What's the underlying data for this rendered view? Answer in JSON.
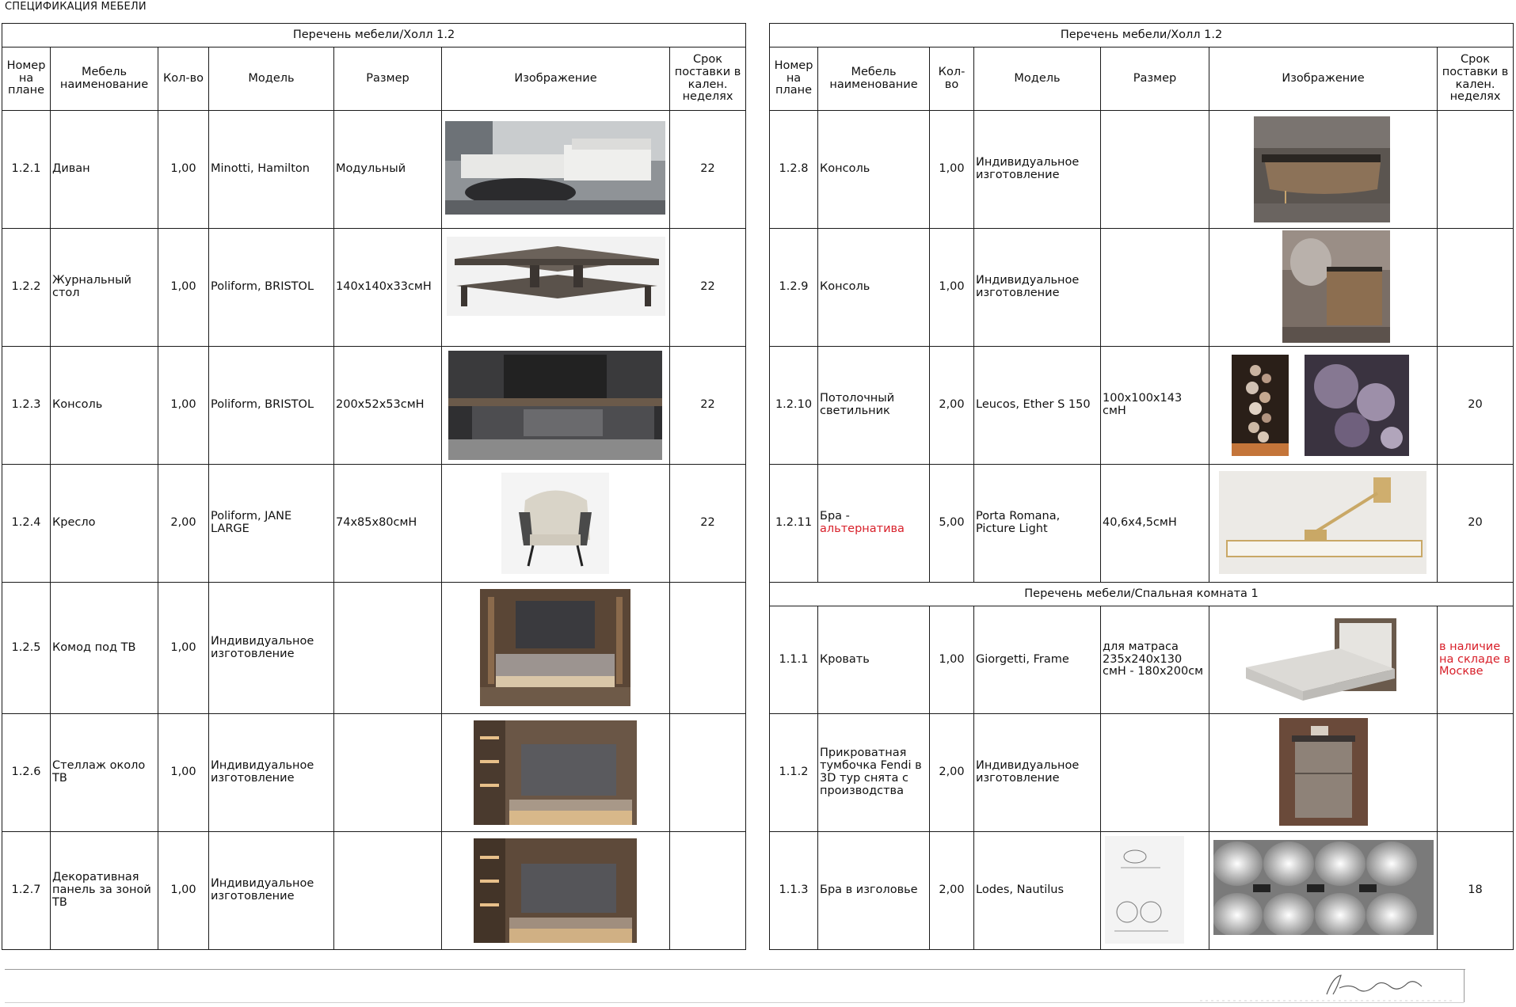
{
  "page": {
    "title": "СПЕЦИФИКАЦИЯ МЕБЕЛИ"
  },
  "headers": {
    "num": "Номер на плане",
    "name": "Мебель наименование",
    "qty_left": "Кол-во",
    "qty_right": "Кол-во",
    "model": "Модель",
    "size": "Размер",
    "image": "Изображение",
    "lead": "Срок поставки в кален. неделях"
  },
  "left_table": {
    "caption": "Перечень мебели/Холл 1.2",
    "rows": [
      {
        "num": "1.2.1",
        "name": "Диван",
        "qty": "1,00",
        "model": "Minotti, Hamilton",
        "size": "Модульный",
        "lead": "22",
        "image": "sofa-photo"
      },
      {
        "num": "1.2.2",
        "name": "Журнальный стол",
        "qty": "1,00",
        "model": "Poliform, BRISTOL",
        "size": "140x140x33cмH",
        "lead": "22",
        "image": "coffee-table-photo"
      },
      {
        "num": "1.2.3",
        "name": "Консоль",
        "qty": "1,00",
        "model": "Poliform, BRISTOL",
        "size": "200x52x53cмH",
        "lead": "22",
        "image": "console-photo"
      },
      {
        "num": "1.2.4",
        "name": "Кресло",
        "qty": "2,00",
        "model": "Poliform, JANE LARGE",
        "size": "74x85x80cмH",
        "lead": "22",
        "image": "armchair-photo"
      },
      {
        "num": "1.2.5",
        "name": "Комод под ТВ",
        "qty": "1,00",
        "model": "Индивидуальное изготовление",
        "size": "",
        "lead": "",
        "image": "tv-cabinet-photo"
      },
      {
        "num": "1.2.6",
        "name": "Стеллаж около ТВ",
        "qty": "1,00",
        "model": "Индивидуальное изготовление",
        "size": "",
        "lead": "",
        "image": "shelving-photo"
      },
      {
        "num": "1.2.7",
        "name": "Декоративная панель за зоной ТВ",
        "qty": "1,00",
        "model": "Индивидуальное изготовление",
        "size": "",
        "lead": "",
        "image": "decor-panel-photo"
      }
    ]
  },
  "right_table": {
    "caption": "Перечень мебели/Холл 1.2",
    "rows": [
      {
        "num": "1.2.8",
        "name": "Консоль",
        "qty": "1,00",
        "model": "Индивидуальное изготовление",
        "size": "",
        "lead": "",
        "image": "console-photo"
      },
      {
        "num": "1.2.9",
        "name": "Консоль",
        "qty": "1,00",
        "model": "Индивидуальное изготовление",
        "size": "",
        "lead": "",
        "image": "console-photo"
      },
      {
        "num": "1.2.10",
        "name": "Потолочный светильник",
        "qty": "2,00",
        "model": "Leucos, Ether S 150",
        "size": "100x100x143 cмH",
        "lead": "20",
        "image": "chandelier-photo"
      },
      {
        "num": "1.2.11",
        "name_main": "Бра -",
        "name_alt": "альтернатива",
        "qty": "5,00",
        "model": "Porta Romana, Picture Light",
        "size": "40,6x4,5cмH",
        "lead": "20",
        "image": "picture-light-photo"
      }
    ],
    "bedroom_caption": "Перечень мебели/Спальная комната 1",
    "bedroom_rows": [
      {
        "num": "1.1.1",
        "name": "Кровать",
        "qty": "1,00",
        "model": "Giorgetti, Frame",
        "size": "для матраса 235x240x130 cмH - 180x200см",
        "lead": "в наличие на складе в Москве",
        "image": "bed-photo"
      },
      {
        "num": "1.1.2",
        "name": "Прикроватная тумбочка Fendi в 3D тур снята с производства",
        "qty": "2,00",
        "model": "Индивидуальное изготовление",
        "size": "",
        "lead": "",
        "image": "nightstand-photo"
      },
      {
        "num": "1.1.3",
        "name": "Бра в изголовье",
        "qty": "2,00",
        "model": "Lodes, Nautilus",
        "size": "",
        "lead": "18",
        "image": "wall-lamp-photo"
      }
    ]
  },
  "colors": {
    "alert": "#d8202a",
    "rule": "#1a1a1a"
  }
}
